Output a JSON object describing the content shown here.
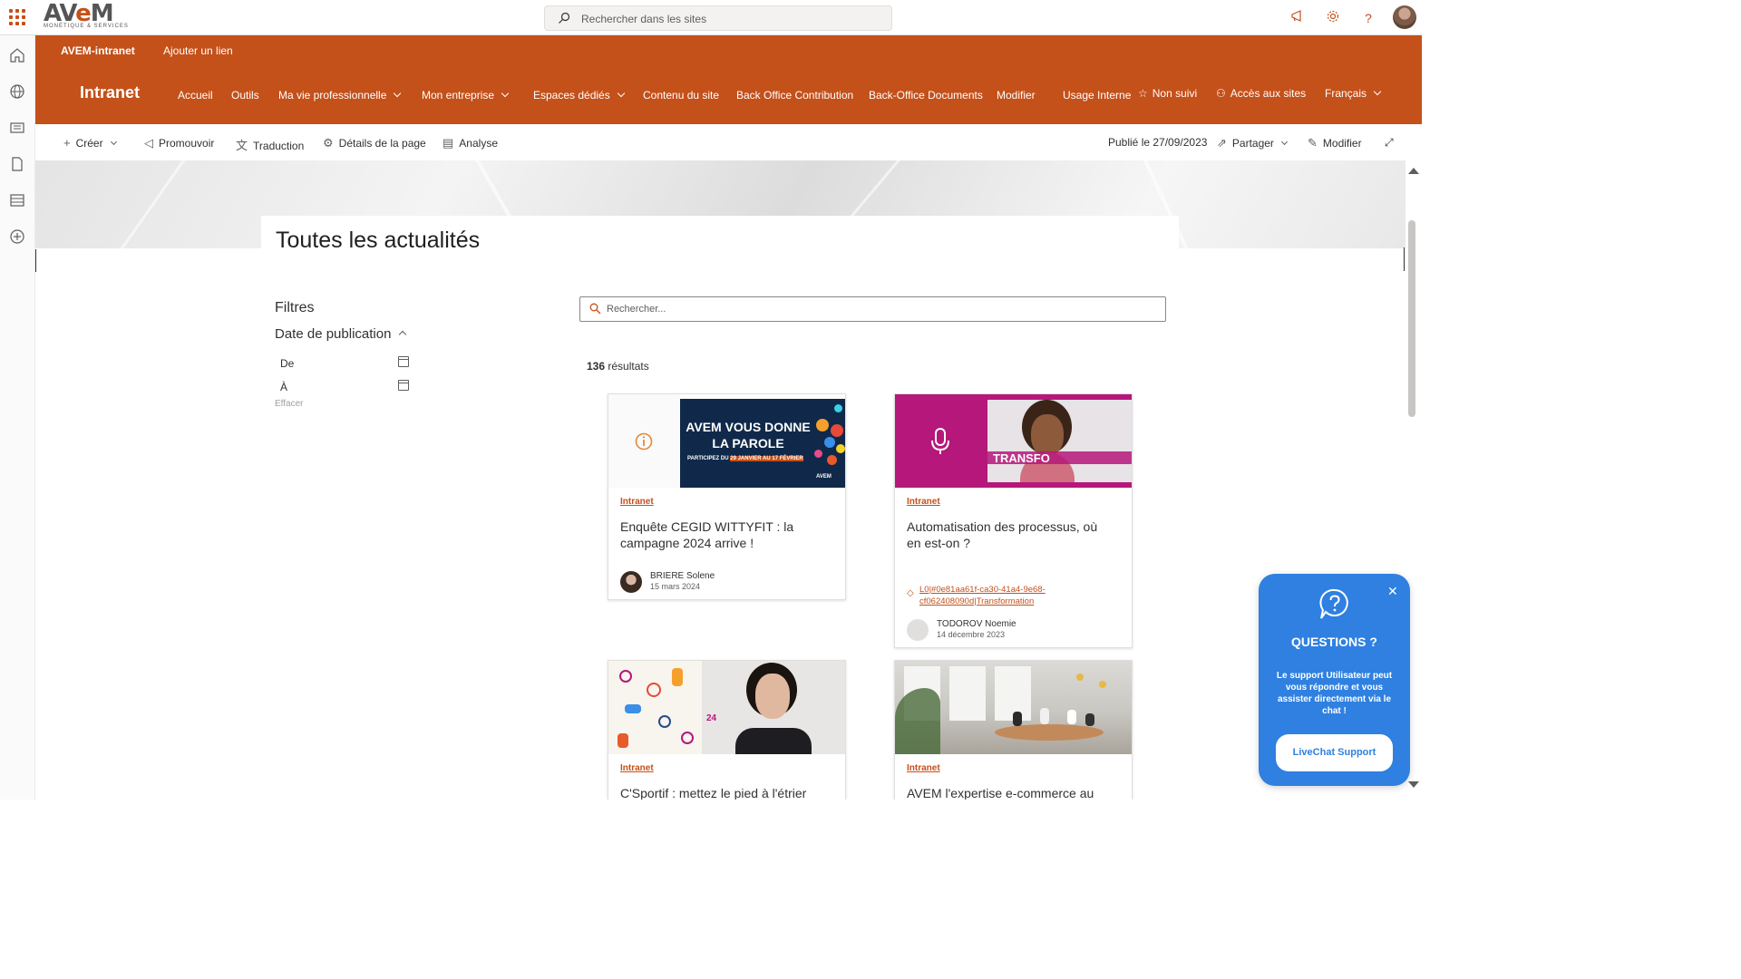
{
  "suite": {
    "brand_main": "AV",
    "brand_accent": "e",
    "brand_end": "M",
    "brand_tagline": "MONÉTIQUE & SERVICES",
    "search_placeholder": "Rechercher dans les sites",
    "icons": [
      "megaphone-icon",
      "gear-icon",
      "help-icon"
    ]
  },
  "hub": {
    "site_name": "AVEM-intranet",
    "add_link": "Ajouter un lien"
  },
  "site": {
    "title": "Intranet",
    "nav": [
      {
        "label": "Accueil"
      },
      {
        "label": "Outils"
      },
      {
        "label": "Ma vie professionnelle"
      },
      {
        "label": "Mon entreprise"
      },
      {
        "label": "Espaces dédiés"
      },
      {
        "label": "Contenu du site"
      },
      {
        "label": "Back Office Contribution"
      },
      {
        "label": "Back-Office Documents"
      },
      {
        "label": "Modifier"
      }
    ],
    "usage": "Usage Interne",
    "follow": "Non suivi",
    "sites_access": "Accès aux sites",
    "language": "Français"
  },
  "command_bar": {
    "create": "Créer",
    "promote": "Promouvoir",
    "translate": "Traduction",
    "page_details": "Détails de la page",
    "analytics": "Analyse",
    "published": "Publié le 27/09/2023",
    "share": "Partager",
    "edit": "Modifier"
  },
  "page": {
    "title": "Toutes les actualités"
  },
  "filters": {
    "title": "Filtres",
    "section": "Date de publication",
    "from": "De",
    "to": "À",
    "clear": "Effacer"
  },
  "search": {
    "placeholder": "Rechercher..."
  },
  "results": {
    "count": "136",
    "label": "résultats"
  },
  "cards": [
    {
      "category": "Intranet",
      "title": "Enquête CEGID WITTYFIT : la campagne 2024 arrive !",
      "author": "BRIERE Solene",
      "date": "15 mars 2024",
      "thumb_line1": "AVEM VOUS DONNE",
      "thumb_line2": "LA PAROLE",
      "thumb_line3_a": "PARTICIPEZ DU",
      "thumb_line3_b": "29 JANVIER AU 17 FÉVRIER",
      "thumb_logo": "AVEM"
    },
    {
      "category": "Intranet",
      "title": "Automatisation des processus, où en est-on ?",
      "tag": "L0|#0e81aa61f-ca30-41a4-9e68-cf062408090d|Transformation",
      "author": "TODOROV Noemie",
      "date": "14 décembre 2023",
      "thumb_label": "TRANSFO"
    },
    {
      "category": "Intranet",
      "title": "C'Sportif : mettez le pied à l'étrier",
      "thumb_badge": "24"
    },
    {
      "category": "Intranet",
      "title": "AVEM l'expertise e-commerce au"
    }
  ],
  "chat": {
    "title": "QUESTIONS ?",
    "description": "Le support Utilisateur peut vous répondre et vous assister directement via le chat !",
    "button": "LiveChat Support"
  },
  "colors": {
    "brand": "#c4501a",
    "chat": "#2f80e0",
    "magenta": "#b5177a",
    "navy": "#10294a"
  }
}
